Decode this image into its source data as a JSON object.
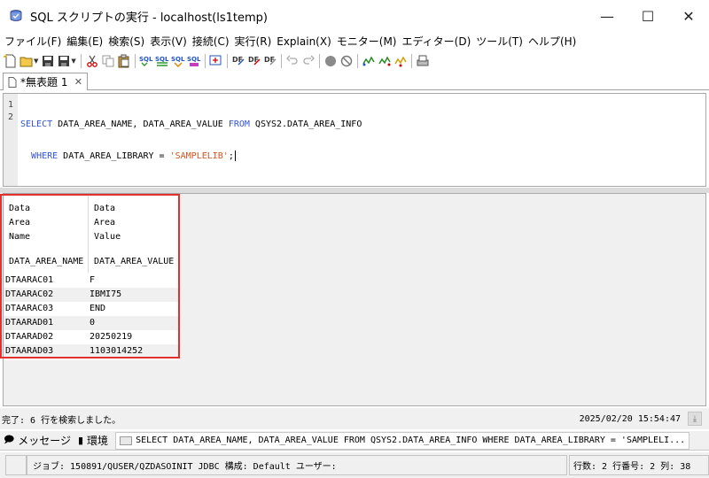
{
  "window": {
    "title": "SQL スクリプトの実行 - localhost(ls1temp)",
    "minimize": "—",
    "maximize": "☐",
    "close": "✕"
  },
  "menu": [
    "ファイル(F)",
    "編集(E)",
    "検索(S)",
    "表示(V)",
    "接続(C)",
    "実行(R)",
    "Explain(X)",
    "モニター(M)",
    "エディター(D)",
    "ツール(T)",
    "ヘルプ(H)"
  ],
  "editor_tab": {
    "label": "*無表題 1",
    "close": "✕"
  },
  "editor": {
    "line_numbers": [
      "1",
      "2"
    ],
    "line1_kw1": "SELECT",
    "line1_rest": " DATA_AREA_NAME, DATA_AREA_VALUE ",
    "line1_kw2": "FROM",
    "line1_tail": " QSYS2.DATA_AREA_INFO",
    "line2_indent": "  ",
    "line2_kw": "WHERE",
    "line2_rest": " DATA_AREA_LIBRARY = ",
    "line2_str": "'SAMPLELIB'",
    "line2_end": ";"
  },
  "results": {
    "headers": [
      {
        "label_lines": "Data\nArea\nName",
        "name": "DATA_AREA_NAME"
      },
      {
        "label_lines": "Data\nArea\nValue",
        "name": "DATA_AREA_VALUE"
      }
    ],
    "rows": [
      [
        "DTAARAC01",
        "F"
      ],
      [
        "DTAARAC02",
        "IBMI75"
      ],
      [
        "DTAARAC03",
        "END"
      ],
      [
        "DTAARAD01",
        "0"
      ],
      [
        "DTAARAD02",
        "20250219"
      ],
      [
        "DTAARAD03",
        "1103014252"
      ]
    ]
  },
  "status": {
    "message": "完了: 6 行を検索しました。",
    "timestamp": "2025/02/20 15:54:47"
  },
  "bottom_tabs": {
    "messages": "メッセージ",
    "environment": "環境",
    "sql": "SELECT DATA_AREA_NAME, DATA_AREA_VALUE FROM QSYS2.DATA_AREA_INFO WHERE DATA_AREA_LIBRARY = 'SAMPLELI..."
  },
  "statusbar": {
    "job": "ジョブ: 150891/QUSER/QZDASOINIT  JDBC 構成: Default  ユーザー:",
    "position": "行数: 2  行番号: 2  列: 38"
  },
  "colors": {
    "keyword": "#3355cc",
    "string": "#cc5522",
    "highlight_border": "#e03030"
  }
}
